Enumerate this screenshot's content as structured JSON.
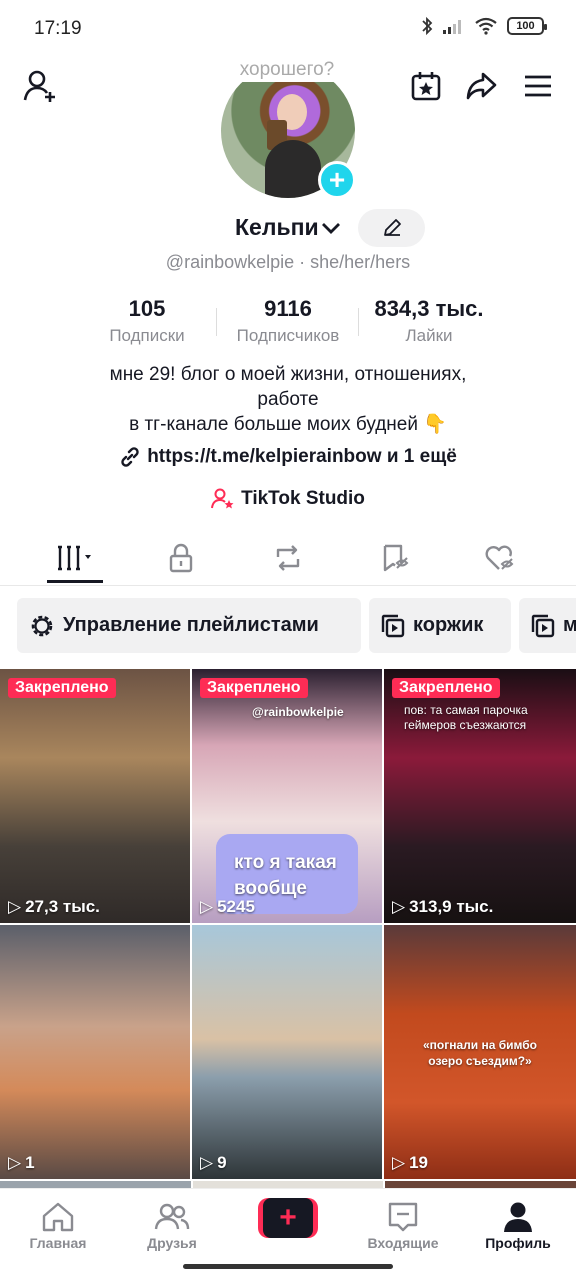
{
  "status_bar": {
    "time": "17:19",
    "battery": "100"
  },
  "profile": {
    "bubble_text": "хорошего?",
    "name": "Кельпи",
    "handle": "@rainbowkelpie · she/her/hers",
    "stats": [
      {
        "value": "105",
        "label": "Подписки"
      },
      {
        "value": "9116",
        "label": "Подписчиков"
      },
      {
        "value": "834,3 тыс.",
        "label": "Лайки"
      }
    ],
    "bio_line1": "мне 29! блог о моей жизни, отношениях,",
    "bio_line2": "работе",
    "bio_line3": "в тг-канале больше моих будней 👇",
    "link": "https://t.me/kelpierainbow и 1 ещё",
    "studio": "TikTok Studio"
  },
  "chips": [
    {
      "label": "Управление плейлистами"
    },
    {
      "label": "коржик"
    },
    {
      "label": "м"
    }
  ],
  "videos": [
    {
      "pinned": "Закреплено",
      "views": "27,3 тыс.",
      "overlay": ""
    },
    {
      "pinned": "Закреплено",
      "views": "5245",
      "overlay": "кто я такая вообще",
      "tag": "@rainbowkelpie"
    },
    {
      "pinned": "Закреплено",
      "views": "313,9 тыс.",
      "overlay": "пов: та самая парочка геймеров съезжаются"
    },
    {
      "pinned": "",
      "views": "1",
      "overlay": ""
    },
    {
      "pinned": "",
      "views": "9",
      "overlay": ""
    },
    {
      "pinned": "",
      "views": "19",
      "overlay": "«погнали на бимбо озеро съездим?»"
    }
  ],
  "nav": [
    {
      "label": "Главная"
    },
    {
      "label": "Друзья"
    },
    {
      "label": "Входящие"
    },
    {
      "label": "Профиль"
    }
  ],
  "colors": {
    "accent": "#fe2c55",
    "cyan": "#20d5ec",
    "text": "#161823",
    "muted": "#8a8b91"
  }
}
